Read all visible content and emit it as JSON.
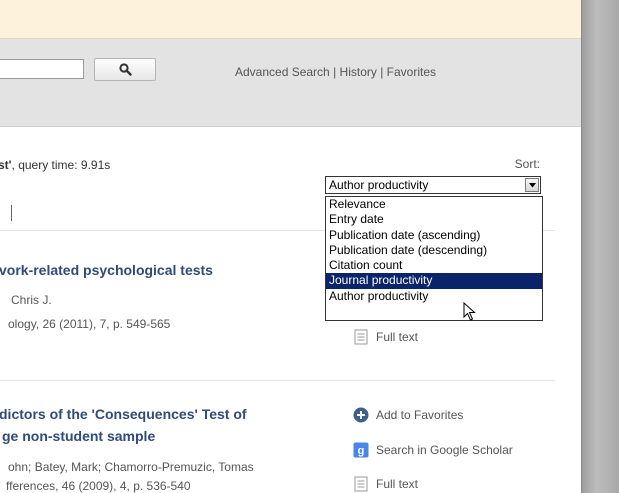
{
  "search": {
    "input_value": "",
    "button_icon": "search-icon"
  },
  "top_links": {
    "advanced": "Advanced Search",
    "sep1": " | ",
    "history": "History",
    "sep2": " | ",
    "favorites": "Favorites"
  },
  "query_info": {
    "prefix": "st'",
    "suffix": ", query time: 9.91s"
  },
  "sort": {
    "label": "Sort:",
    "selected": "Author productivity",
    "options": [
      "Relevance",
      "Entry date",
      "Publication date (ascending)",
      "Publication date (descending)",
      "Citation count",
      "Journal productivity",
      "Author productivity"
    ],
    "highlighted_index": 5
  },
  "results": [
    {
      "title_lines": [
        "vork-related psychological tests"
      ],
      "authors": "Chris J.",
      "source": "ology, 26 (2011), 7, p. 549-565",
      "actions": [
        {
          "label": "Full text",
          "icon": "document-icon"
        }
      ]
    },
    {
      "title_lines": [
        "dictors of the 'Consequences' Test of",
        "ge non-student sample"
      ],
      "authors": "ohn; Batey, Mark; Chamorro-Premuzic, Tomas",
      "source": "fferences, 46 (2009), 4, p. 536-540",
      "actions": [
        {
          "label": "Add to Favorites",
          "icon": "plus-circle-icon"
        },
        {
          "label": "Search in Google Scholar",
          "icon": "google-scholar-icon"
        },
        {
          "label": "Full text",
          "icon": "document-icon"
        }
      ]
    }
  ],
  "colors": {
    "header_band": "#fdf3dc",
    "search_bar": "#e3e3e3",
    "title": "#2e4b7a",
    "highlight": "#0a246a"
  }
}
